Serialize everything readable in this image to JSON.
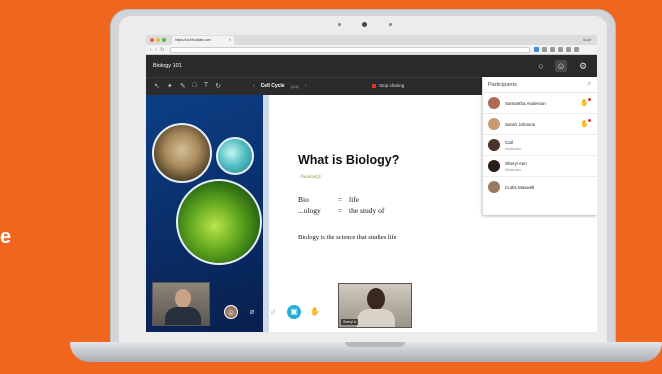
{
  "side_text": "e",
  "browser": {
    "tab_title": "https://us.bbcollab.com",
    "tab_close": "×",
    "url": "",
    "user_label": "Scott",
    "nav": "‹ › ↻"
  },
  "app": {
    "title": "Biology 101",
    "chat_icon": "○",
    "attendees_icon": "☺",
    "settings_icon": "⚙"
  },
  "toolbar": {
    "tools": [
      "↖",
      "✦",
      "✎",
      "□",
      "T",
      "↻"
    ],
    "prev": "‹",
    "next": "›",
    "slide_name": "Cell Cycle",
    "slide_count": "(1/4)",
    "stop_sharing": "Stop sharing"
  },
  "slide": {
    "title": "What is Biology?",
    "phonetic": "/baiɒlədʒi/",
    "defs": [
      {
        "term": "Bio",
        "eq": "=",
        "meaning": "life"
      },
      {
        "term": "...ology",
        "eq": "=",
        "meaning": "the study of"
      }
    ],
    "body": "Biology is the science that studies life"
  },
  "videos": {
    "presenter_name": "",
    "student_name": "Sheryl A"
  },
  "controls": [
    "☺",
    "⌀",
    "⌀",
    "▣",
    "✋"
  ],
  "participants": {
    "title": "Participants",
    "search_icon": "⌕",
    "hand_icon": "✋",
    "list": [
      {
        "name": "Samantha Anderson",
        "role": "",
        "avatar": "#b06a52",
        "hand": true
      },
      {
        "name": "Sarah Johnson",
        "role": "",
        "avatar": "#c99a72",
        "hand": true
      },
      {
        "name": "Carl",
        "role": "Moderator",
        "avatar": "#4a3328",
        "hand": false
      },
      {
        "name": "Sheryl Ann",
        "role": "Moderator",
        "avatar": "#2a1d19",
        "hand": false
      },
      {
        "name": "Curtis Maxwell",
        "role": "",
        "avatar": "#9a7a62",
        "hand": false
      }
    ]
  },
  "colors": {
    "background": "#f0661f",
    "header": "#2b2b2d",
    "accent": "#1fb0d8",
    "stop": "#e0342a"
  }
}
